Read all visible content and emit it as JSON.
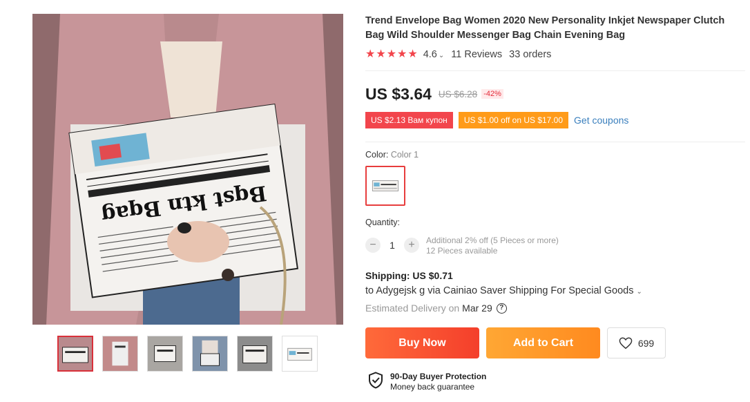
{
  "product": {
    "title": "Trend Envelope Bag Women 2020 New Personality Inkjet Newspaper Clutch Bag Wild Shoulder Messenger Bag Chain Evening Bag",
    "rating": "4.6",
    "rating_stars": 5,
    "reviews": "11 Reviews",
    "orders": "33 orders"
  },
  "pricing": {
    "price": "US $3.64",
    "old_price": "US $6.28",
    "discount": "-42%",
    "coupon_red": "US $2.13 Вам купон",
    "coupon_orange": "US $1.00 off on US $17.00",
    "get_coupons": "Get coupons",
    "accent_red": "#f2454c",
    "accent_orange": "#ff9b19"
  },
  "gallery": {
    "main_photo_icon": "product-photo-newspaper-clutch",
    "newspaper_headline": "Bqst ktn Bqag",
    "thumbnail_count": 6
  },
  "options": {
    "color_label": "Color:",
    "color_value": "Color 1",
    "quantity_label": "Quantity:",
    "quantity_value": "1",
    "minus": "−",
    "plus": "+",
    "additional_offer": "Additional 2% off (5 Pieces or more)",
    "available": "12 Pieces available"
  },
  "shipping": {
    "title": "Shipping: US $0.71",
    "line": "to Adygejsk g via Cainiao Saver Shipping For Special Goods",
    "estimated_label": "Estimated Delivery on",
    "estimated_date": "Mar 29",
    "help_symbol": "?"
  },
  "actions": {
    "buy_now": "Buy Now",
    "add_to_cart": "Add to Cart",
    "wishlist_count": "699"
  },
  "protection": {
    "title": "90-Day Buyer Protection",
    "subtitle": "Money back guarantee"
  }
}
